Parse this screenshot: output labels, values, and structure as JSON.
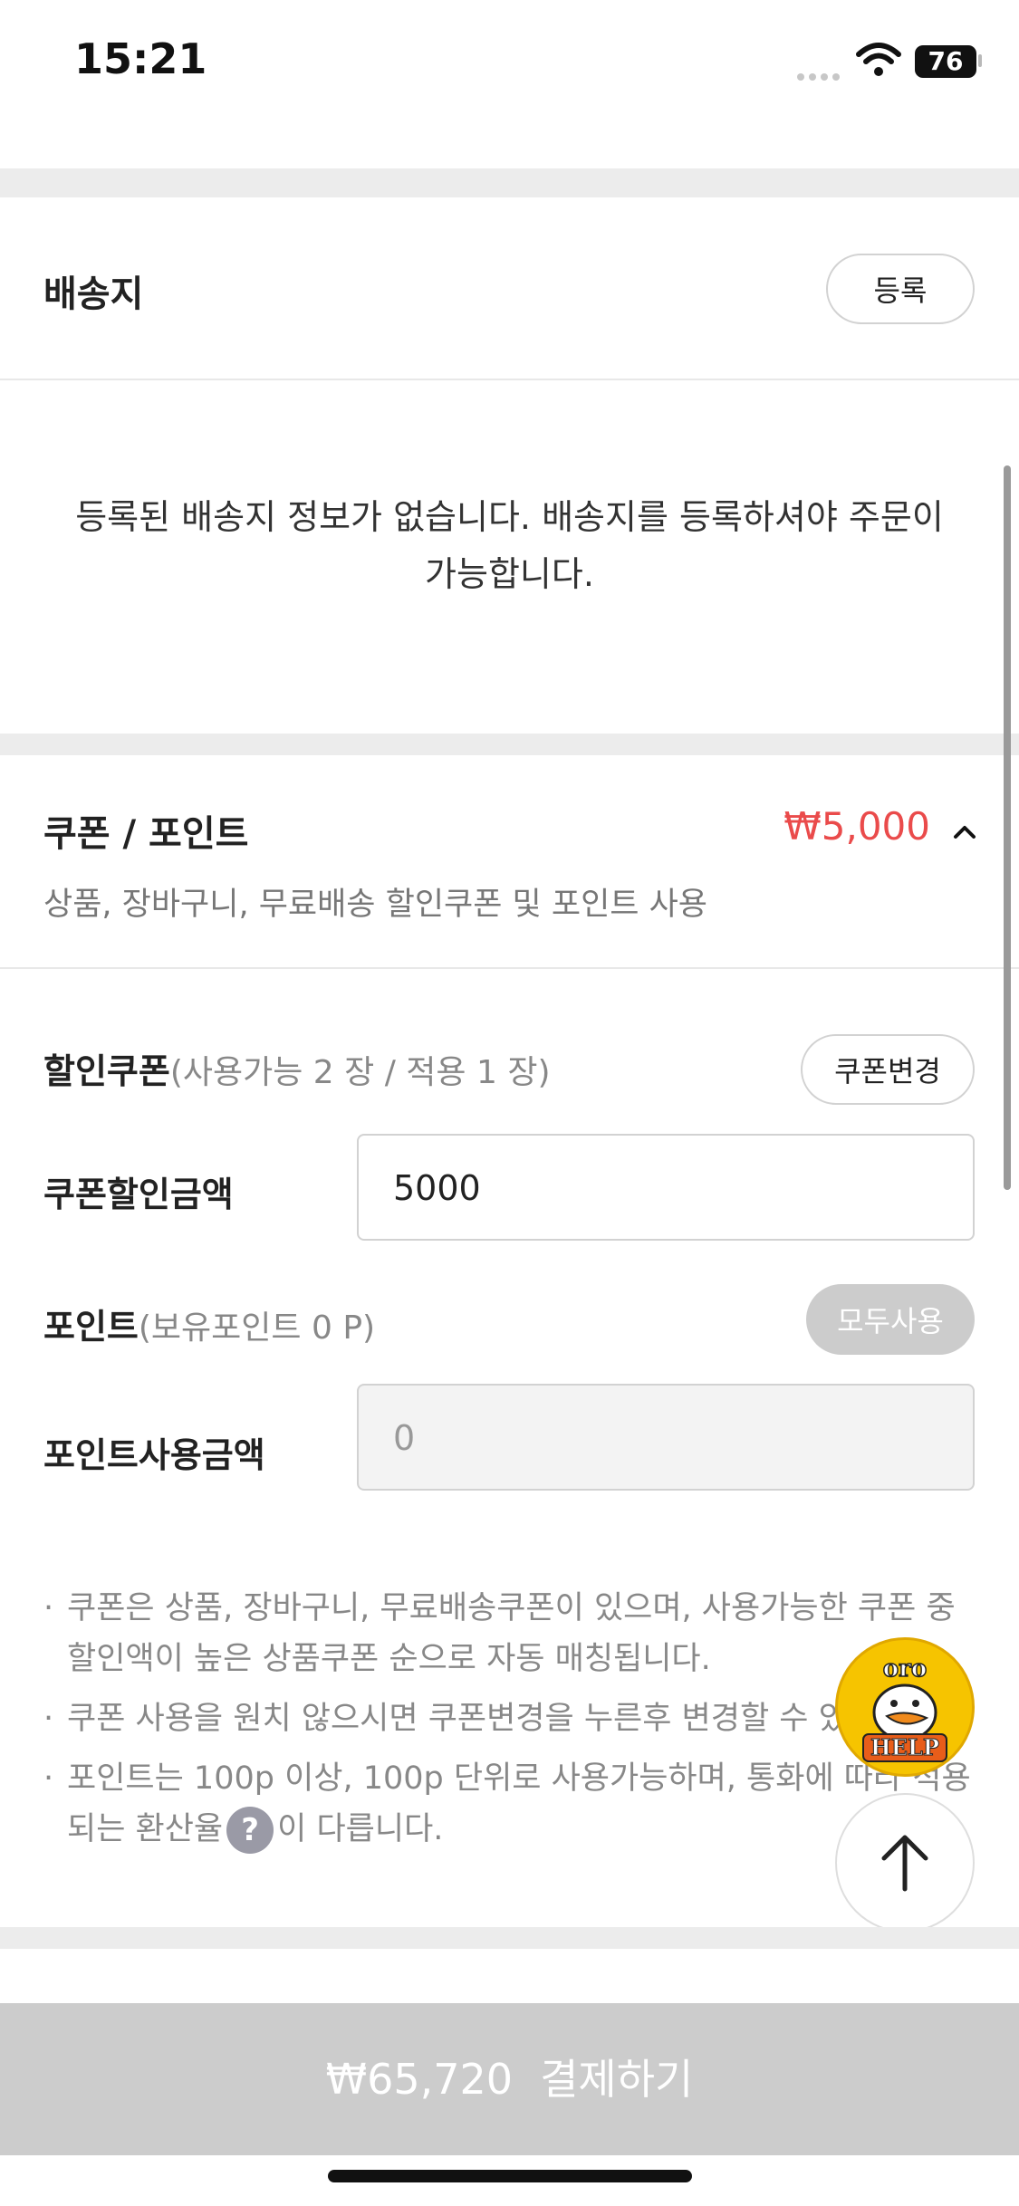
{
  "status_bar": {
    "time": "15:21",
    "battery": "76"
  },
  "shipping": {
    "title": "배송지",
    "register_button": "등록",
    "empty_message": "등록된 배송지 정보가 없습니다. 배송지를 등록하셔야 주문이 가능합니다."
  },
  "coupon_point": {
    "title": "쿠폰 / 포인트",
    "discount_total": "₩5,000",
    "subtitle": "상품, 장바구니, 무료배송 할인쿠폰 및 포인트 사용",
    "coupon_label": "할인쿠폰",
    "coupon_detail": "(사용가능  2 장 / 적용 1 장)",
    "change_coupon_button": "쿠폰변경",
    "coupon_amount_label": "쿠폰할인금액",
    "coupon_amount_value": "5000",
    "point_label": "포인트",
    "point_detail": "(보유포인트  0 P)",
    "use_all_button": "모두사용",
    "point_amount_label": "포인트사용금액",
    "point_amount_placeholder": "0"
  },
  "notes": {
    "note1": "쿠폰은 상품, 장바구니, 무료배송쿠폰이 있으며, 사용가능한 쿠폰 중 할인액이 높은 상품쿠폰 순으로 자동 매칭됩니다.",
    "note2": "쿠폰 사용을 원치 않으시면 쿠폰변경을 누른후 변경할 수 있",
    "note3_before": "포인트는 100p 이상, 100p 단위로 사용가능하며, 통화에 따라 적용되는 환산율",
    "note3_help": "?",
    "note3_after": "이 다릅니다."
  },
  "help_badge": {
    "top_text": "oro",
    "bottom_text": "HELP"
  },
  "checkout": {
    "price": "₩65,720",
    "label": "결제하기"
  },
  "icons": {
    "wifi": "wifi-icon",
    "chevron": "chevron-up-icon",
    "scroll_top": "arrow-up-icon",
    "help_mascot": "duck-mascot-icon"
  },
  "colors": {
    "accent_red": "#ea4b4b",
    "disabled_gray": "#cccccc",
    "section_gap": "#ececec"
  }
}
